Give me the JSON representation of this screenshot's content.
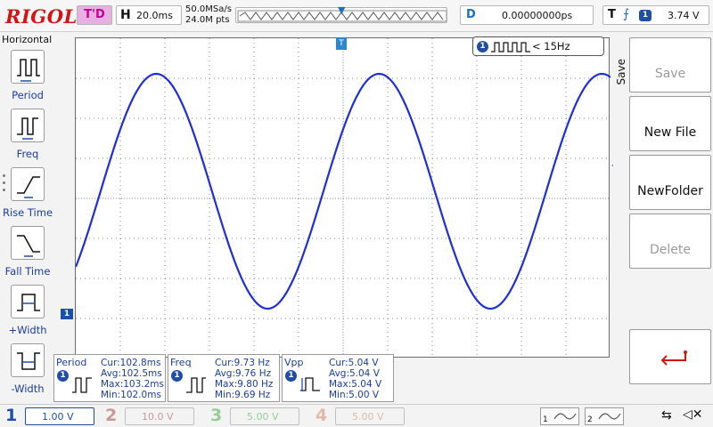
{
  "topbar": {
    "logo": "RIGOL",
    "status": "T'D",
    "timebase_key": "H",
    "timebase_value": "20.0ms",
    "sample_rate": "50.0MSa/s",
    "memory_depth": "24.0M pts",
    "delay_key": "D",
    "delay_value": "0.00000000ps",
    "trigger_key": "T",
    "trigger_channel": "1",
    "trigger_level": "3.74 V"
  },
  "left_menu": {
    "title": "Horizontal",
    "items": [
      {
        "label": "Period",
        "icon": "period-icon"
      },
      {
        "label": "Freq",
        "icon": "freq-icon"
      },
      {
        "label": "Rise Time",
        "icon": "rise-time-icon"
      },
      {
        "label": "Fall Time",
        "icon": "fall-time-icon"
      },
      {
        "label": "+Width",
        "icon": "positive-width-icon"
      },
      {
        "label": "-Width",
        "icon": "negative-width-icon"
      }
    ]
  },
  "screen": {
    "freq_indicator_channel": "1",
    "freq_indicator_text": "< 15Hz",
    "ch1_marker": "1",
    "trace_color": "#1f2fd6"
  },
  "measurements": [
    {
      "name": "Period",
      "channel": "1",
      "cur": "Cur:102.8ms",
      "avg": "Avg:102.5ms",
      "max": "Max:103.2ms",
      "min": "Min:102.0ms"
    },
    {
      "name": "Freq",
      "channel": "1",
      "cur": "Cur:9.73 Hz",
      "avg": "Avg:9.76 Hz",
      "max": "Max:9.80 Hz",
      "min": "Min:9.69 Hz"
    },
    {
      "name": "Vpp",
      "channel": "1",
      "cur": "Cur:5.04 V",
      "avg": "Avg:5.04 V",
      "max": "Max:5.04 V",
      "min": "Min:5.00 V"
    }
  ],
  "right_menu": {
    "title": "Save",
    "buttons": [
      {
        "label": "Save",
        "enabled": false
      },
      {
        "label": "New File",
        "enabled": true
      },
      {
        "label": "NewFolder",
        "enabled": true
      },
      {
        "label": "Delete",
        "enabled": false
      }
    ]
  },
  "bottombar": {
    "channels": [
      {
        "num": "1",
        "scale": "1.00 V"
      },
      {
        "num": "2",
        "scale": "10.0 V"
      },
      {
        "num": "3",
        "scale": "5.00 V"
      },
      {
        "num": "4",
        "scale": "5.00 V"
      }
    ],
    "math1": "1",
    "math2": "2",
    "usb_icon": "usb-icon",
    "speaker_icon": "speaker-muted-icon"
  }
}
